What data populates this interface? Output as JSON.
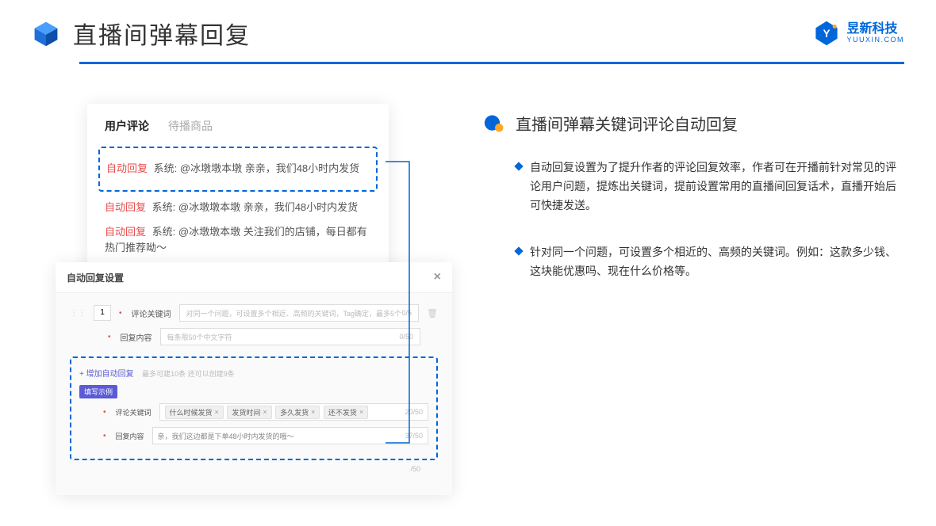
{
  "header": {
    "title": "直播间弹幕回复",
    "brand_name": "昱新科技",
    "brand_url": "YUUXIN.COM"
  },
  "comments": {
    "tab_active": "用户评论",
    "tab_inactive": "待播商品",
    "auto_tag": "自动回复",
    "system_label": "系统:",
    "items": [
      "@冰墩墩本墩 亲亲，我们48小时内发货",
      "@冰墩墩本墩 亲亲，我们48小时内发货",
      "@冰墩墩本墩 关注我们的店铺，每日都有热门推荐呦～"
    ]
  },
  "modal": {
    "title": "自动回复设置",
    "index": "1",
    "keyword_label": "评论关键词",
    "keyword_placeholder": "对同一个问题，可设置多个相近、高频的关键词，Tag确定，最多5个",
    "keyword_counter": "0/5",
    "content_label": "回复内容",
    "content_placeholder": "每条限50个中文字符",
    "content_counter": "0/50",
    "add_label": "+ 增加自动回复",
    "add_hint": "最多可建10条 还可以创建9条",
    "example_tag": "填写示例",
    "ex_keyword_label": "评论关键词",
    "ex_chips": [
      "什么时候发货",
      "发货时间",
      "多久发货",
      "还不发货"
    ],
    "ex_keyword_counter": "20/50",
    "ex_content_label": "回复内容",
    "ex_content_value": "亲，我们这边都是下单48小时内发货的哦～",
    "ex_content_counter": "37/50",
    "bottom_counter": "/50"
  },
  "right": {
    "section_title": "直播间弹幕关键词评论自动回复",
    "bullets": [
      "自动回复设置为了提升作者的评论回复效率，作者可在开播前针对常见的评论用户问题，提炼出关键词，提前设置常用的直播间回复话术，直播开始后可快捷发送。",
      "针对同一个问题，可设置多个相近的、高频的关键词。例如：这款多少钱、这块能优惠吗、现在什么价格等。"
    ]
  }
}
